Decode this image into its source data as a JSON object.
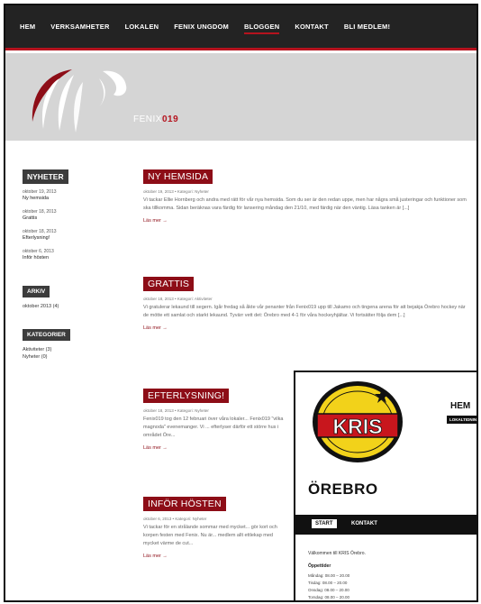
{
  "nav": {
    "items": [
      {
        "label": "HEM"
      },
      {
        "label": "VERKSAMHETER"
      },
      {
        "label": "LOKALEN"
      },
      {
        "label": "FENIX UNGDOM"
      },
      {
        "label": "BLOGGEN"
      },
      {
        "label": "KONTAKT"
      },
      {
        "label": "BLI MEDLEM!"
      }
    ],
    "active": "BLOGGEN"
  },
  "logo": {
    "text_prefix": "FENIX",
    "text_suffix": "019"
  },
  "sidebar": {
    "news_heading": "NYHETER",
    "news": [
      {
        "date": "oktober 19, 2013",
        "title": "Ny hemsida"
      },
      {
        "date": "oktober 18, 2013",
        "title": "Grattis"
      },
      {
        "date": "oktober 18, 2013",
        "title": "Efterlysning!"
      },
      {
        "date": "oktober 6, 2013",
        "title": "Inför hösten"
      }
    ],
    "archive_heading": "ARKIV",
    "archive": [
      "oktober 2013 (4)"
    ],
    "categories_heading": "KATEGORIER",
    "categories": [
      "Aktiviteter (3)",
      "Nyheter (0)"
    ]
  },
  "posts": [
    {
      "title": "NY HEMSIDA",
      "meta": "oktober 19, 2013 • Kategori: Nyheter",
      "excerpt": "Vi tackar Ellie Hornberg och andra med rätt för vår nya hemsida. Som du ser är den redan uppe, men har några små justeringar och funktioner som ska tillkomma. Sidan beräknas vara färdig för lansering måndag den 21/10, med färdig när den väntig. Läsa tanken är [...]",
      "more": "Läs mer →"
    },
    {
      "title": "GRATTIS",
      "meta": "oktober 18, 2013 • Kategori: Aktiviteter",
      "excerpt": "Vi gratulerar lekaund till segern. Igår fredag så åkte vår penanter från Fenix019 upp till Jakamo och tingena arena för att bejakja Örebro hockey när de mötte ett samlat och starkt lekaund. Tyvärr vett det: Örebro med 4-1 för våra hockeyhjältar. Vi fortsätter följa dem [...]",
      "more": "Läs mer →"
    },
    {
      "title": "EFTERLYSNING!",
      "meta": "oktober 18, 2013 • Kategori: Nyheter",
      "excerpt": "Fenix019 tog den 12 februari över våra lokaler... Fenix019 \"vilka magnoda\" evenemanger. Vi ... efterlyser därför ett större hus i området Öre...",
      "more": "Läs mer →"
    },
    {
      "title": "INFÖR HÖSTEN",
      "meta": "oktober 6, 2013 • Kategori: Nyheter",
      "excerpt": "Vi tackar för en strålande sommar med mycket... gör kort och korpen festen med Fenix. Nu är... medlem allt ettlekap med mycket värme de cut...",
      "more": "Läs mer →"
    }
  ],
  "overlay": {
    "logo_text": "KRIS",
    "nav_hem": "HEM",
    "nav_lokal": "LOKALTIDNING",
    "city": "ÖREBRO",
    "tab_start": "START",
    "tab_kontakt": "KONTAKT",
    "welcome": "Välkommen till KRIS Örebro.",
    "hours_title": "Öppettider",
    "hours": [
      "Måndag: 08.00 – 20.00",
      "Tisdag: 08.00 – 20.00",
      "Onsdag: 08.00 – 20.00",
      "Torsdag: 08.00 – 20.00"
    ]
  },
  "colors": {
    "accent": "#8d0d17",
    "nav_bg": "#232323",
    "header_bg": "#d5d5d5",
    "kris_yellow": "#f2d21a",
    "kris_red": "#c8161d"
  }
}
